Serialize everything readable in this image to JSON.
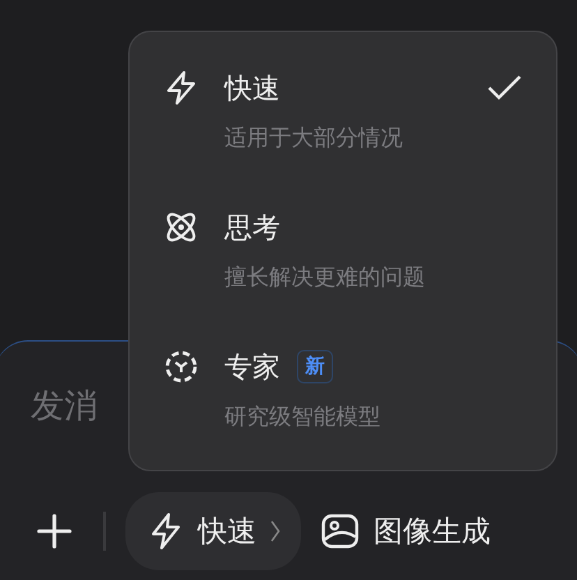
{
  "composer": {
    "placeholder": "发消",
    "toolbar": {
      "mode_button": {
        "label": "快速"
      },
      "image_button": {
        "label": "图像生成"
      }
    }
  },
  "mode_menu": {
    "items": [
      {
        "kind": "fast",
        "title": "快速",
        "subtitle": "适用于大部分情况",
        "selected": true
      },
      {
        "kind": "think",
        "title": "思考",
        "subtitle": "擅长解决更难的问题",
        "selected": false
      },
      {
        "kind": "expert",
        "title": "专家",
        "badge": "新",
        "subtitle": "研究级智能模型",
        "selected": false
      }
    ]
  }
}
